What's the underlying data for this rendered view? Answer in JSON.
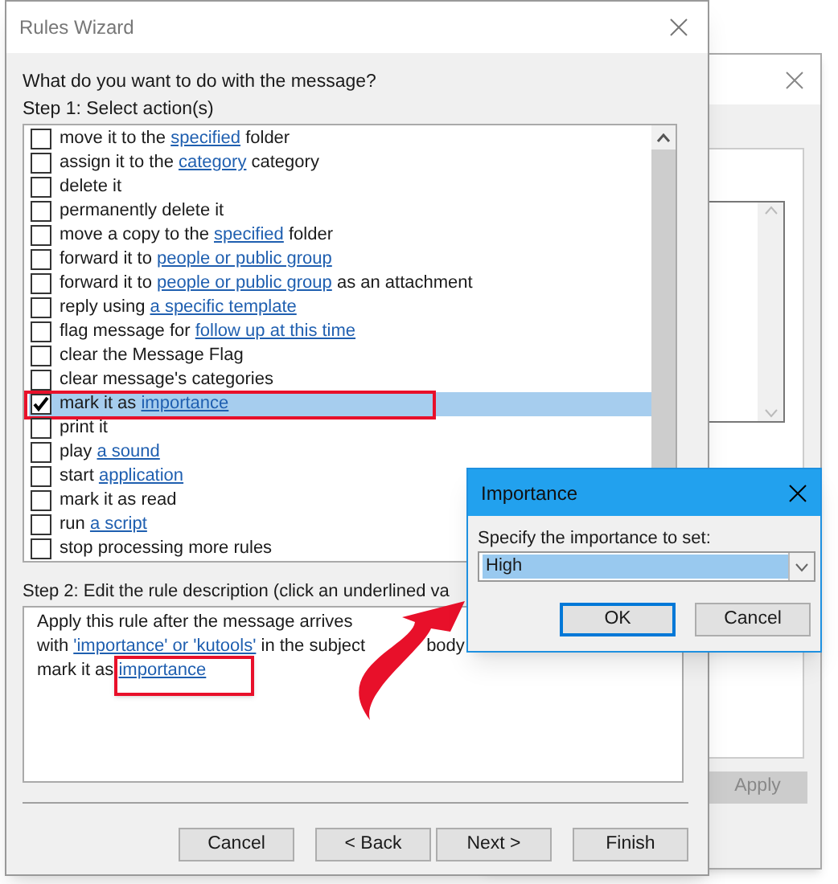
{
  "background_window": {
    "apply_button": {
      "label": "Apply",
      "disabled": true
    }
  },
  "rules_wizard": {
    "title": "Rules Wizard",
    "question": "What do you want to do with the message?",
    "step1_label": "Step 1: Select action(s)",
    "actions": [
      {
        "parts": [
          {
            "text": "move it to the "
          },
          {
            "text": "specified",
            "link": true
          },
          {
            "text": " folder"
          }
        ],
        "checked": false,
        "selected": false
      },
      {
        "parts": [
          {
            "text": "assign it to the "
          },
          {
            "text": "category",
            "link": true
          },
          {
            "text": " category"
          }
        ],
        "checked": false,
        "selected": false
      },
      {
        "parts": [
          {
            "text": "delete it"
          }
        ],
        "checked": false,
        "selected": false
      },
      {
        "parts": [
          {
            "text": "permanently delete it"
          }
        ],
        "checked": false,
        "selected": false
      },
      {
        "parts": [
          {
            "text": "move a copy to the "
          },
          {
            "text": "specified",
            "link": true
          },
          {
            "text": " folder"
          }
        ],
        "checked": false,
        "selected": false
      },
      {
        "parts": [
          {
            "text": "forward it to "
          },
          {
            "text": "people or public group",
            "link": true
          }
        ],
        "checked": false,
        "selected": false
      },
      {
        "parts": [
          {
            "text": "forward it to "
          },
          {
            "text": "people or public group",
            "link": true
          },
          {
            "text": " as an attachment"
          }
        ],
        "checked": false,
        "selected": false
      },
      {
        "parts": [
          {
            "text": "reply using "
          },
          {
            "text": "a specific template",
            "link": true
          }
        ],
        "checked": false,
        "selected": false
      },
      {
        "parts": [
          {
            "text": "flag message for "
          },
          {
            "text": "follow up at this time",
            "link": true
          }
        ],
        "checked": false,
        "selected": false
      },
      {
        "parts": [
          {
            "text": "clear the Message Flag"
          }
        ],
        "checked": false,
        "selected": false
      },
      {
        "parts": [
          {
            "text": "clear message's categories"
          }
        ],
        "checked": false,
        "selected": false
      },
      {
        "parts": [
          {
            "text": "mark it as "
          },
          {
            "text": "importance",
            "link": true
          }
        ],
        "checked": true,
        "selected": true,
        "highlighted": true
      },
      {
        "parts": [
          {
            "text": "print it"
          }
        ],
        "checked": false,
        "selected": false
      },
      {
        "parts": [
          {
            "text": "play "
          },
          {
            "text": "a sound",
            "link": true
          }
        ],
        "checked": false,
        "selected": false
      },
      {
        "parts": [
          {
            "text": "start "
          },
          {
            "text": "application",
            "link": true
          }
        ],
        "checked": false,
        "selected": false
      },
      {
        "parts": [
          {
            "text": "mark it as read"
          }
        ],
        "checked": false,
        "selected": false
      },
      {
        "parts": [
          {
            "text": "run "
          },
          {
            "text": "a script",
            "link": true
          }
        ],
        "checked": false,
        "selected": false
      },
      {
        "parts": [
          {
            "text": "stop processing more rules"
          }
        ],
        "checked": false,
        "selected": false
      }
    ],
    "step2_label": "Step 2: Edit the rule description (click an underlined va",
    "description": [
      [
        {
          "text": "Apply this rule after the message arrives"
        }
      ],
      [
        {
          "text": "with "
        },
        {
          "text": "'importance' or 'kutools'",
          "link": true
        },
        {
          "text": " in the subject"
        },
        {
          "text": "body",
          "after_gap": true
        }
      ],
      [
        {
          "text": "mark it as "
        },
        {
          "text": "importance",
          "link": true,
          "highlighted": true
        }
      ]
    ],
    "buttons": [
      "Cancel",
      "< Back",
      "Next >",
      "Finish"
    ]
  },
  "importance_dialog": {
    "title": "Importance",
    "prompt": "Specify the importance to set:",
    "value": "High",
    "buttons": [
      "OK",
      "Cancel"
    ]
  }
}
